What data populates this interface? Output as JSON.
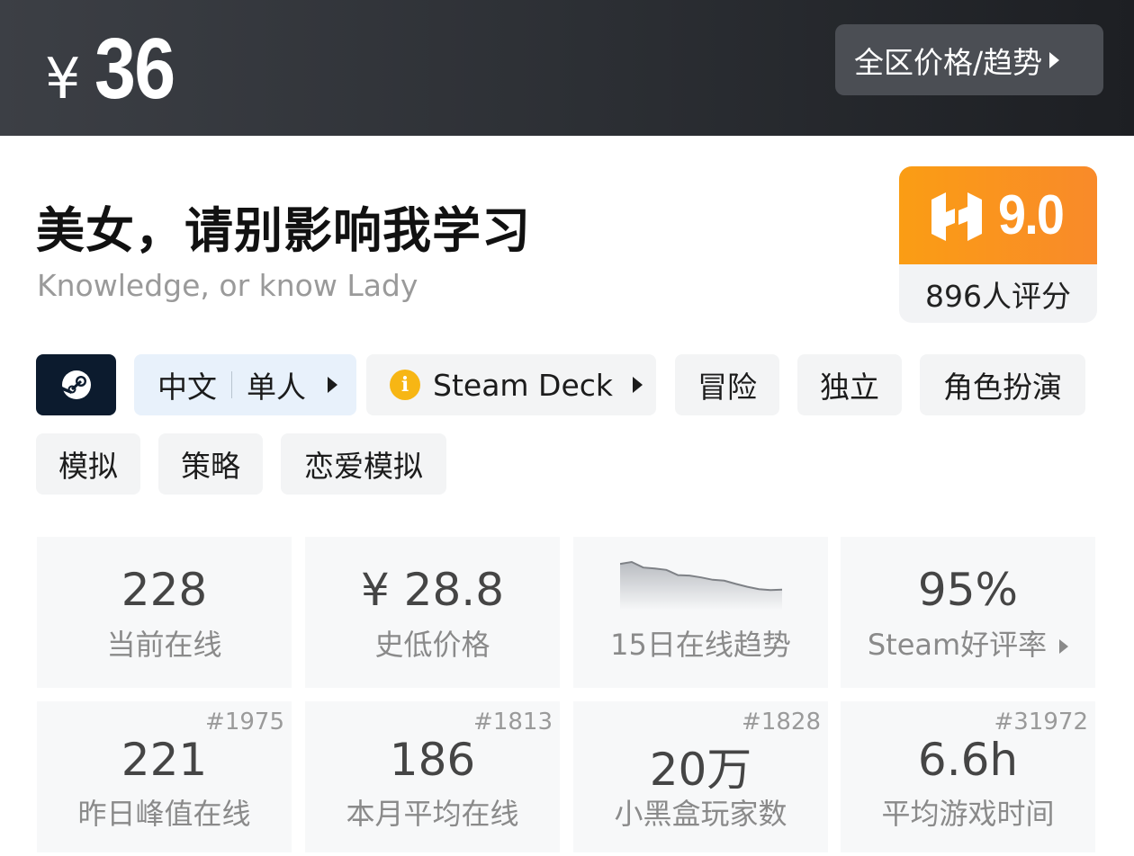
{
  "header": {
    "currency": "¥",
    "price": "36",
    "region_button_label": "全区价格/趋势"
  },
  "game": {
    "title": "美女，请别影响我学习",
    "subtitle": "Knowledge, or know Lady"
  },
  "score": {
    "value": "9.0",
    "count_label": "896人评分",
    "colors": {
      "from": "#fa9d14",
      "to": "#f98a2a"
    }
  },
  "tags": {
    "platform_icon": "steam-icon",
    "language": "中文",
    "mode": "单人",
    "deck_icon": "info-icon",
    "deck_label": "Steam Deck",
    "genres": [
      "冒险",
      "独立",
      "角色扮演",
      "模拟",
      "策略",
      "恋爱模拟"
    ]
  },
  "stats": [
    {
      "value": "228",
      "label": "当前在线"
    },
    {
      "value": "¥ 28.8",
      "label": "史低价格"
    },
    {
      "value": "",
      "label": "15日在线趋势"
    },
    {
      "value": "95%",
      "label": "Steam好评率"
    },
    {
      "value": "221",
      "label": "昨日峰值在线",
      "rank": "#1975"
    },
    {
      "value": "186",
      "label": "本月平均在线",
      "rank": "#1813"
    },
    {
      "value": "20万",
      "label": "小黑盒玩家数",
      "rank": "#1828"
    },
    {
      "value": "6.6h",
      "label": "平均游戏时间",
      "rank": "#31972"
    }
  ],
  "chart_data": {
    "type": "area",
    "x": [
      1,
      2,
      3,
      4,
      5,
      6,
      7,
      8,
      9,
      10,
      11,
      12,
      13,
      14,
      15
    ],
    "values": [
      96,
      100,
      88,
      86,
      83,
      72,
      71,
      67,
      62,
      60,
      53,
      47,
      42,
      40,
      41
    ],
    "title": "15日在线趋势",
    "ylim": [
      0,
      100
    ],
    "grid": false,
    "legend": "none"
  }
}
